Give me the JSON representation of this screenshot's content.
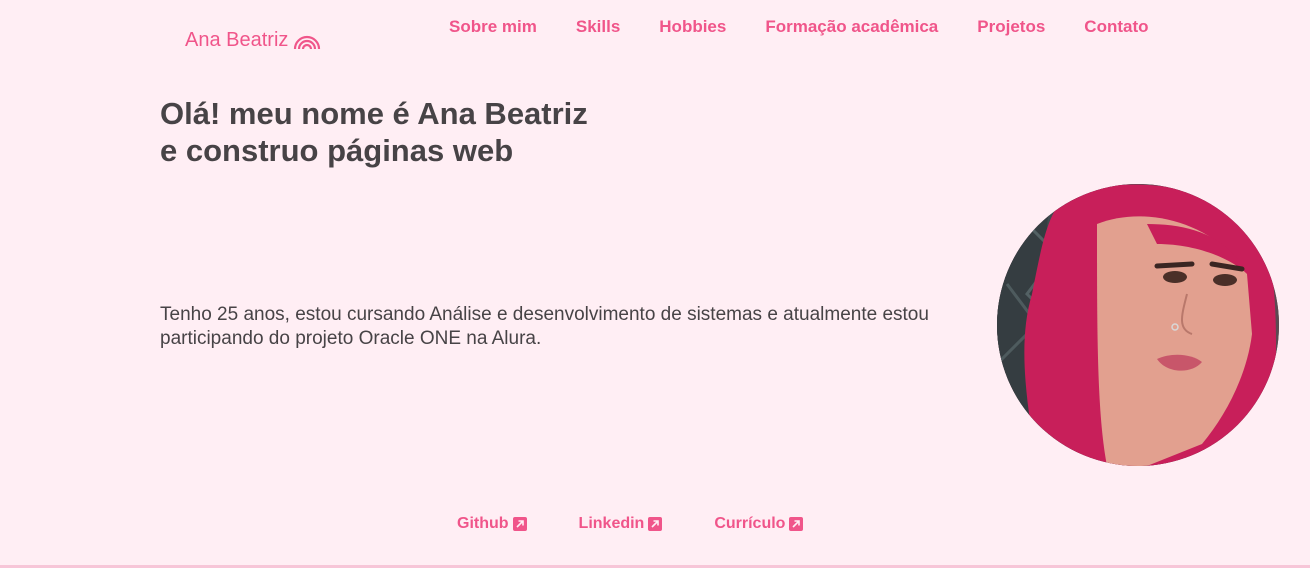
{
  "header": {
    "logo_text": "Ana Beatriz",
    "logo_icon": "rainbow-icon",
    "nav": [
      {
        "label": "Sobre mim"
      },
      {
        "label": "Skills"
      },
      {
        "label": "Hobbies"
      },
      {
        "label": "Formação acadêmica"
      },
      {
        "label": "Projetos"
      },
      {
        "label": "Contato"
      }
    ]
  },
  "hero": {
    "title_line1": "Olá! meu nome é Ana Beatriz",
    "title_line2": "e construo páginas web",
    "description": "Tenho 25 anos, estou cursando Análise e desenvolvimento de sistemas e atualmente estou participando do projeto Oracle ONE na Alura."
  },
  "links": [
    {
      "label": "Github",
      "icon": "external-link-icon"
    },
    {
      "label": "Linkedin",
      "icon": "external-link-icon"
    },
    {
      "label": "Currículo",
      "icon": "external-link-icon"
    }
  ],
  "colors": {
    "background": "#ffeef4",
    "accent": "#f0558a",
    "text": "#474346"
  }
}
